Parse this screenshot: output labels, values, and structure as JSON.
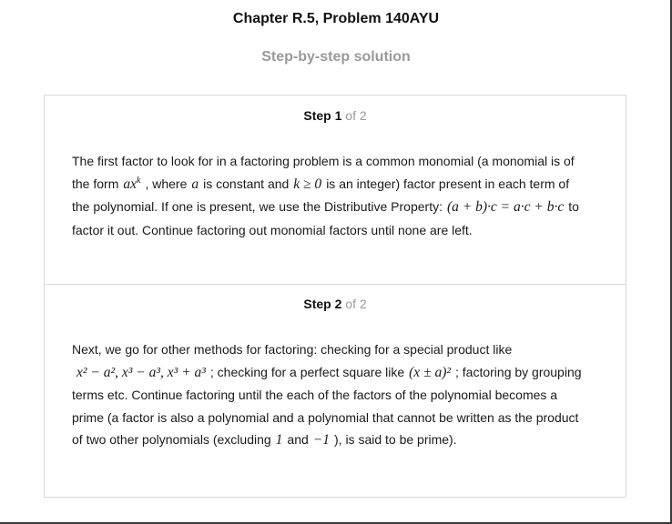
{
  "header": {
    "chapter_title": "Chapter R.5, Problem 140AYU",
    "subtitle": "Step-by-step solution"
  },
  "steps": [
    {
      "word": "Step",
      "number": "1",
      "of_total": "of 2",
      "lines": [
        [
          "The first factor to look for in a factoring problem is a common monomial (a monomial is of"
        ],
        [
          "the form",
          ", where",
          "is constant and",
          "is an integer) factor present in each term of"
        ],
        [
          "the polynomial. If one is present, we use the Distributive Property:",
          "to"
        ],
        [
          "factor it out. Continue factoring out monomial factors until none are left."
        ]
      ],
      "math": {
        "monomial_base": "ax",
        "monomial_exp": "k",
        "constant": "a",
        "k_condition": "k ≥ 0",
        "distributive": "(a + b)·c = a·c + b·c"
      }
    },
    {
      "word": "Step",
      "number": "2",
      "of_total": "of 2",
      "lines": [
        [
          "Next, we go for other methods for factoring: checking for a special product like"
        ],
        [
          "; checking for a perfect square like",
          "; factoring by grouping"
        ],
        [
          "terms etc. Continue factoring until the each of the factors of the polynomial becomes a"
        ],
        [
          "prime (a factor is also a polynomial and a polynomial that cannot be written as the product"
        ],
        [
          "of two other polynomials (excluding",
          "and",
          "), is said to be prime)."
        ]
      ],
      "math": {
        "special_products": "x² − a², x³ − a³, x³ + a³",
        "perfect_square": "(x ± a)²",
        "one": "1",
        "minus_one": "−1"
      }
    }
  ]
}
